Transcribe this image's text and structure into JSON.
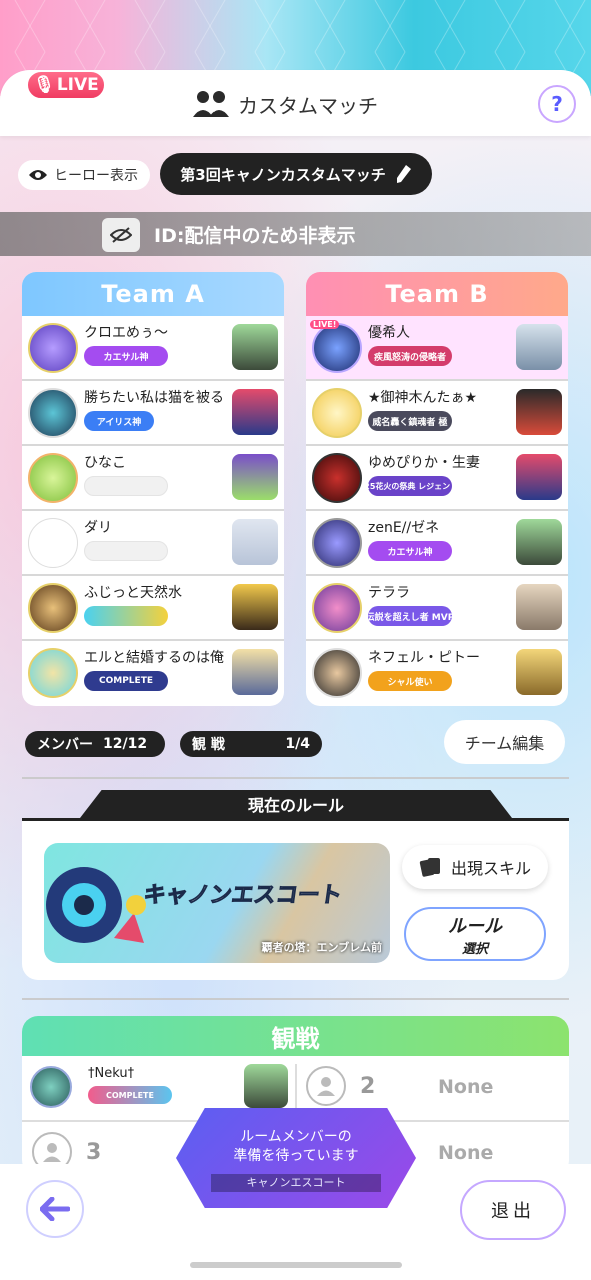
{
  "header": {
    "live_label": "LIVE",
    "title": "カスタムマッチ",
    "help_label": "?"
  },
  "toolbar": {
    "hero_toggle": "ヒーロー表示",
    "match_name": "第3回キャノンカスタムマッチ"
  },
  "id_bar": {
    "text": "ID:配信中のため非表示"
  },
  "teams": [
    {
      "name": "Team A",
      "members": [
        {
          "name": "クロエめぅ〜",
          "badge": "カエサル神",
          "badge_color": "#a44cf0"
        },
        {
          "name": "勝ちたい私は猫を被る",
          "badge": "アイリス神",
          "badge_color": "#3b7ef5"
        },
        {
          "name": "ひなこ",
          "badge": "",
          "badge_color": ""
        },
        {
          "name": "ダリ",
          "badge": "",
          "badge_color": ""
        },
        {
          "name": "ふじっと天然水",
          "badge": "",
          "badge_color": "#6a5cf0"
        },
        {
          "name": "エルと結婚するのは俺",
          "badge": "COMPLETE",
          "badge_color": "#2f3b8f"
        }
      ]
    },
    {
      "name": "Team B",
      "members": [
        {
          "name": "優希人",
          "badge": "疾風怒涛の侵略者",
          "badge_color": "#d43c6b",
          "live": "LIVE!"
        },
        {
          "name": "★御神木んたぁ★",
          "badge": "威名轟く鎮魂者 極",
          "badge_color": "#4a4a5c"
        },
        {
          "name": "ゆめぴりか・生妻",
          "badge": "'25花火の祭典 レジェンド",
          "badge_color": "#6a43c9"
        },
        {
          "name": "zenE//ゼネ",
          "badge": "カエサル神",
          "badge_color": "#a44cf0"
        },
        {
          "name": "テララ",
          "badge": "伝説を超えし者 MVP",
          "badge_color": "#7a58e8"
        },
        {
          "name": "ネフェル・ピトー",
          "badge": "シャル使い",
          "badge_color": "#f2a21c"
        }
      ]
    }
  ],
  "status": {
    "members_label": "メンバー",
    "members_value": "12/12",
    "spectators_label": "観 戦",
    "spectators_value": "1/4",
    "team_edit": "チーム編集"
  },
  "rule": {
    "heading": "現在のルール",
    "mode": "キャノンエスコート",
    "stage": "覇者の塔：エンブレム前",
    "skill_button": "出現スキル",
    "rule_button_line1": "ルール",
    "rule_button_line2": "選択"
  },
  "spectators": {
    "heading": "観戦",
    "slots": [
      {
        "name": "†Neku†",
        "badge": "COMPLETE"
      },
      {
        "number": "2",
        "value": "None"
      },
      {
        "number": "3",
        "value": "N"
      },
      {
        "number": "",
        "value": "None"
      }
    ]
  },
  "waiting": {
    "line1": "ルームメンバーの",
    "line2": "準備を待っています",
    "sub": "キャノンエスコート"
  },
  "footer": {
    "quit": "退出"
  }
}
